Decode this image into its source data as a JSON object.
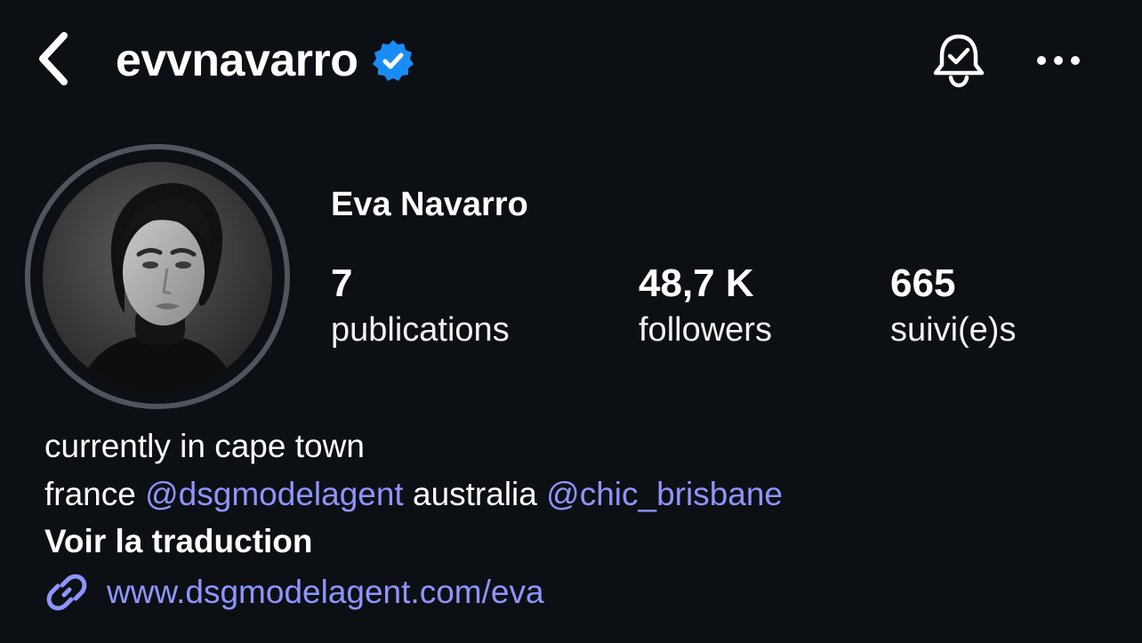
{
  "header": {
    "username": "evvnavarro",
    "back_icon": "chevron-left-icon",
    "verified_icon": "verified-badge-icon",
    "notification_icon": "bell-check-icon",
    "more_icon": "more-horizontal-icon"
  },
  "profile": {
    "display_name": "Eva Navarro",
    "avatar_description": "profile-photo",
    "stats": {
      "posts": {
        "value": "7",
        "label": "publications"
      },
      "followers": {
        "value": "48,7 K",
        "label": "followers"
      },
      "following": {
        "value": "665",
        "label": "suivi(e)s"
      }
    }
  },
  "bio": {
    "line1": "currently in cape town",
    "line2_prefix": "france ",
    "mention1": "@dsgmodelagent",
    "line2_middle": " australia ",
    "mention2": "@chic_brisbane",
    "translate_label": "Voir la traduction",
    "link_icon": "link-icon",
    "link_text": "www.dsgmodelagent.com/eva"
  },
  "colors": {
    "background": "#0c0f14",
    "text": "#ffffff",
    "accent_link": "#8e95ff",
    "verified_blue": "#1a8cf5",
    "avatar_ring": "#50545c"
  }
}
